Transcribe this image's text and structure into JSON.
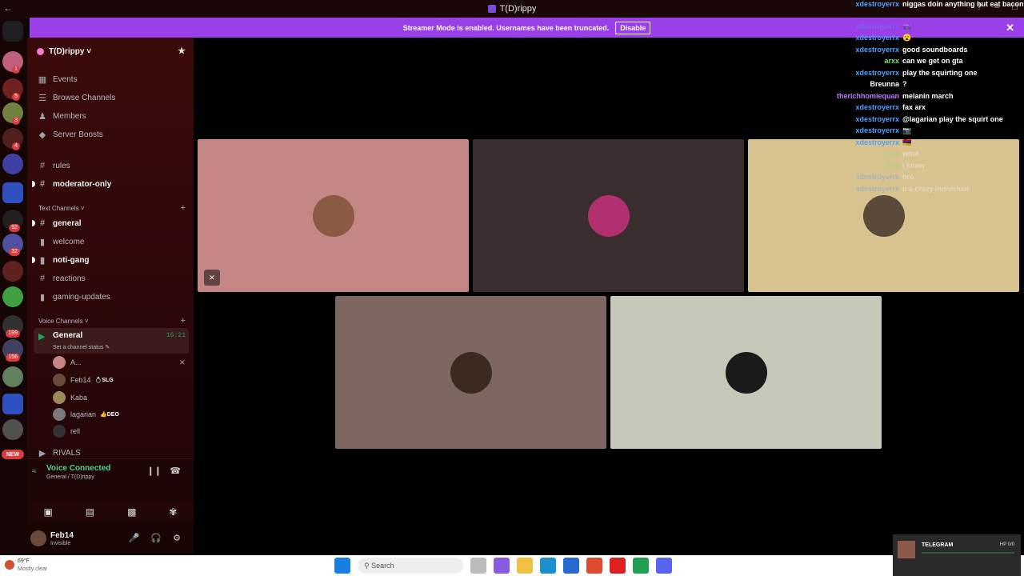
{
  "window": {
    "title": "T(D)rippy"
  },
  "banner": {
    "text": "Streamer Mode is enabled. Usernames have been truncated.",
    "disable_label": "Disable"
  },
  "server": {
    "name": "T(D)rippy ˅"
  },
  "nav": [
    {
      "label": "Events",
      "icon": "calendar-icon"
    },
    {
      "label": "Browse Channels",
      "icon": "browse-icon"
    },
    {
      "label": "Members",
      "icon": "members-icon"
    },
    {
      "label": "Server Boosts",
      "icon": "boost-icon"
    }
  ],
  "channels_top": [
    {
      "label": "rules",
      "bold": false
    },
    {
      "label": "moderator-only",
      "bold": true
    }
  ],
  "text_category": "Text Channels ˅",
  "text_channels": [
    {
      "label": "general",
      "bold": true,
      "icon": "hash-icon"
    },
    {
      "label": "welcome",
      "bold": false,
      "icon": "speaker-icon"
    },
    {
      "label": "noti-gang",
      "bold": true,
      "icon": "speaker-icon"
    },
    {
      "label": "reactions",
      "bold": false,
      "icon": "hash-icon"
    },
    {
      "label": "gaming-updates",
      "bold": false,
      "icon": "speaker-icon"
    }
  ],
  "voice_category": "Voice Channels ˅",
  "voice_channel": {
    "name": "General",
    "time": "16:21",
    "status": "Set a channel status ✎"
  },
  "members": [
    {
      "name": "A...",
      "tag": "",
      "color": "#c68484"
    },
    {
      "name": "Feb14",
      "tag": "💍SLG",
      "color": "#6a4b3b"
    },
    {
      "name": "Kaba",
      "tag": "",
      "color": "#9c8a5a"
    },
    {
      "name": "lagarian",
      "tag": "👍DEO",
      "color": "#7a7a7a"
    },
    {
      "name": "rell",
      "tag": "",
      "color": "#333333"
    }
  ],
  "rivals": "RIVALS",
  "voice_status": {
    "title": "Voice Connected",
    "sub": "General / T(D)rippy"
  },
  "user": {
    "name": "Feb14",
    "status": "Invisible"
  },
  "tiles": [
    {
      "bg": "#c58686",
      "muted": true,
      "av": "#8a5a44"
    },
    {
      "bg": "#3a2d2e",
      "muted": false,
      "av": "#b03070"
    },
    {
      "bg": "#d8c28f",
      "muted": false,
      "av": "#5a4a3a"
    },
    {
      "bg": "#7e6760",
      "muted": false,
      "av": "#3b2a20"
    },
    {
      "bg": "#c8c8ba",
      "muted": false,
      "av": "#1a1a1a"
    }
  ],
  "chat": [
    {
      "user": "xdestroyerrx",
      "text": "niggas doin anything but eat bacon",
      "color": "#4aa3ff",
      "faded": false
    },
    {
      "user": "xdestroyerrx",
      "text": "📷",
      "color": "#4aa3ff",
      "faded": true
    },
    {
      "user": "xdestroyerrx",
      "text": "😮",
      "color": "#4aa3ff",
      "faded": false
    },
    {
      "user": "xdestroyerrx",
      "text": "good soundboards",
      "color": "#4aa3ff",
      "faded": false
    },
    {
      "user": "arxx",
      "text": "can we get on gta",
      "color": "#6be46b",
      "faded": false
    },
    {
      "user": "xdestroyerrx",
      "text": "play the squirting one",
      "color": "#4aa3ff",
      "faded": false
    },
    {
      "user": "Breunna",
      "text": "?",
      "color": "#ffffff",
      "faded": false
    },
    {
      "user": "therichhomiequan",
      "text": "melanin march",
      "color": "#c07bff",
      "faded": false
    },
    {
      "user": "xdestroyerrx",
      "text": "fax arx",
      "color": "#4aa3ff",
      "faded": false
    },
    {
      "user": "xdestroyerrx",
      "text": "@lagarian play the squirt one",
      "color": "#4aa3ff",
      "faded": false
    },
    {
      "user": "xdestroyerrx",
      "text": "📷",
      "color": "#4aa3ff",
      "faded": false
    },
    {
      "user": "xdestroyerrx",
      "text": "🇦🇲",
      "color": "#4aa3ff",
      "faded": false
    },
    {
      "user": "arxx",
      "text": "what",
      "color": "#6be46b",
      "faded": true
    },
    {
      "user": "arxx",
      "text": "i know",
      "color": "#6be46b",
      "faded": true
    },
    {
      "user": "xdestroyerrx",
      "text": "bro",
      "color": "#4aa3ff",
      "faded": true
    },
    {
      "user": "xdestroyerrx",
      "text": "u a crazy individual",
      "color": "#4aa3ff",
      "faded": true
    }
  ],
  "taskbar": {
    "temp": "69°F",
    "weather": "Mostly clear",
    "search": "Search"
  },
  "telegram": {
    "title": "TELEGRAM",
    "hp": "HP 0/0"
  }
}
